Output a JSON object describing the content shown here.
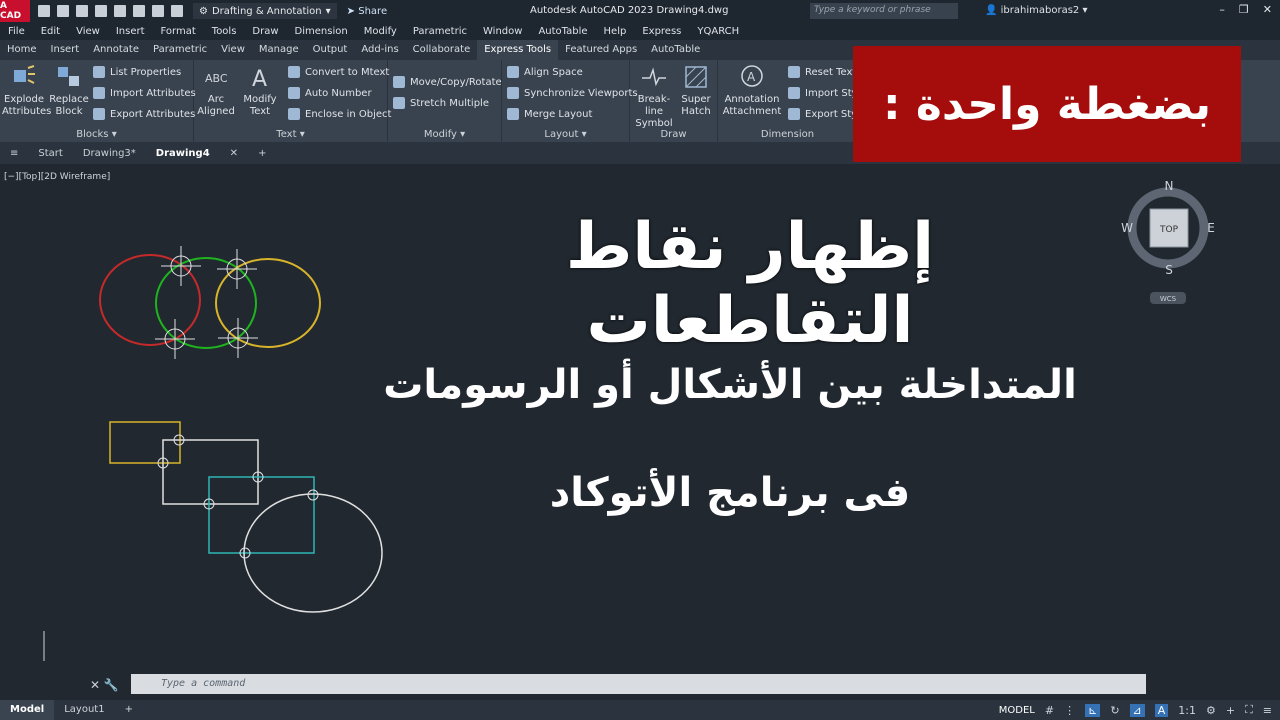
{
  "app": {
    "logo": "A CAD",
    "workspace": "Drafting & Annotation",
    "share": "Share",
    "title": "Autodesk AutoCAD 2023   Drawing4.dwg",
    "search_placeholder": "Type a keyword or phrase",
    "user": "ibrahimaboras2"
  },
  "menu": [
    "File",
    "Edit",
    "View",
    "Insert",
    "Format",
    "Tools",
    "Draw",
    "Dimension",
    "Modify",
    "Parametric",
    "Window",
    "AutoTable",
    "Help",
    "Express",
    "YQARCH"
  ],
  "ribbon_tabs": [
    "Home",
    "Insert",
    "Annotate",
    "Parametric",
    "View",
    "Manage",
    "Output",
    "Add-ins",
    "Collaborate",
    "Express Tools",
    "Featured Apps",
    "AutoTable"
  ],
  "active_ribbon_tab": "Express Tools",
  "panels": {
    "blocks": {
      "title": "Blocks",
      "explode": "Explode\nAttributes",
      "replace": "Replace\nBlock",
      "list_props": "List Properties",
      "import_attr": "Import Attributes",
      "export_attr": "Export Attributes"
    },
    "text": {
      "title": "Text",
      "arc_aligned": "Arc\nAligned",
      "modify_text": "Modify\nText",
      "convert": "Convert to Mtext",
      "auto_number": "Auto Number",
      "enclose": "Enclose in Object"
    },
    "modify": {
      "title": "Modify",
      "move_copy": "Move/Copy/Rotate",
      "stretch": "Stretch Multiple"
    },
    "layout": {
      "title": "Layout",
      "align": "Align Space",
      "sync": "Synchronize Viewports",
      "merge": "Merge Layout"
    },
    "draw": {
      "title": "Draw",
      "breakline": "Break-line\nSymbol",
      "superhatch": "Super\nHatch"
    },
    "dimension": {
      "title": "Dimension",
      "annotation": "Annotation\nAttachment",
      "reset": "Reset Text",
      "import_st": "Import Sty",
      "export_st": "Export Sty"
    }
  },
  "doc_tabs": [
    "Start",
    "Drawing3*",
    "Drawing4"
  ],
  "active_doc": "Drawing4",
  "viewport_label": "[−][Top][2D Wireframe]",
  "overlay": {
    "banner": "بضغطة واحدة :",
    "title": "إظهار نقاط التقاطعات",
    "line2": "المتداخلة بين الأشكال أو الرسومات",
    "line3": "فى برنامج الأتوكاد"
  },
  "viewcube": {
    "n": "N",
    "s": "S",
    "e": "E",
    "w": "W",
    "top": "TOP",
    "wcs": "WCS"
  },
  "command_placeholder": "Type a command",
  "layout_tabs": [
    "Model",
    "Layout1"
  ],
  "status": {
    "model": "MODEL",
    "scale": "1:1"
  },
  "colors": {
    "red": "#c42a2a",
    "green": "#1fb31f",
    "yellow": "#d8b42a",
    "cyan": "#2fb5b5",
    "white": "#e0e0e0",
    "banner": "#a50c0c"
  }
}
